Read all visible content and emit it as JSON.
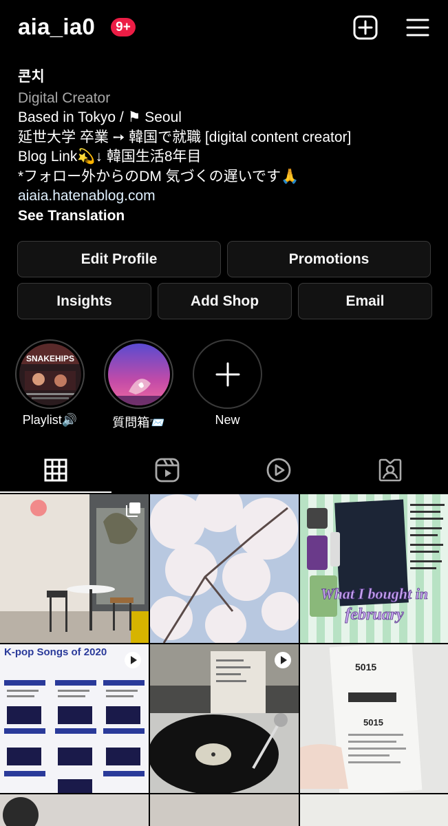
{
  "header": {
    "username": "aia_ia0",
    "notification_badge": "9+",
    "create_icon": "plus-square-icon",
    "menu_icon": "hamburger-menu-icon"
  },
  "bio": {
    "name": "콘치",
    "category": "Digital Creator",
    "lines": [
      "Based in Tokyo / ⚑ Seoul",
      "延世大学 卒業 ➙ 韓国で就職 [digital content creator]",
      "Blog Link💫↓ 韓国生活8年目",
      "*フォロー外からのDM 気づくの遅いです🙏"
    ],
    "link": "aiaia.hatenablog.com",
    "see_translation": "See Translation"
  },
  "buttons": {
    "edit_profile": "Edit Profile",
    "promotions": "Promotions",
    "insights": "Insights",
    "add_shop": "Add Shop",
    "email": "Email"
  },
  "highlights": [
    {
      "label": "Playlist🔊",
      "cover_text": "SNAKEHIPS"
    },
    {
      "label": "質問箱📨"
    },
    {
      "label": "New"
    }
  ],
  "tabs": [
    {
      "name": "posts-grid-icon"
    },
    {
      "name": "reels-icon"
    },
    {
      "name": "videos-icon"
    },
    {
      "name": "tagged-icon"
    }
  ],
  "posts": {
    "feb_title_line1": "What I bought in",
    "feb_title_line2": "february",
    "kpop_title": "K-pop Songs of 2020",
    "receipt_number": "5015"
  },
  "colors": {
    "background": "#000000",
    "badge": "#ec1d45",
    "link": "#e0f1ff",
    "button_bg": "#121212"
  }
}
